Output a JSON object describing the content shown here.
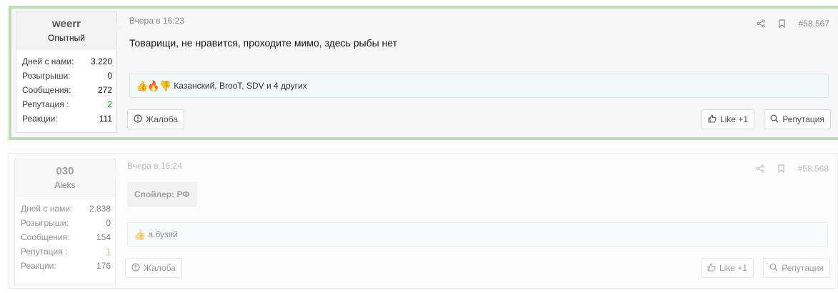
{
  "posts": [
    {
      "user": {
        "name": "weerr",
        "title": "Опытный",
        "stats": [
          {
            "label": "Дней с нами:",
            "value": "3.220"
          },
          {
            "label": "Розыгрыши:",
            "value": "0"
          },
          {
            "label": "Сообщения:",
            "value": "272"
          },
          {
            "label": "Репутация :",
            "value": "2"
          },
          {
            "label": "Реакции:",
            "value": "111"
          }
        ]
      },
      "date": "Вчера в 16:23",
      "post_number": "#58.567",
      "message": "Товарищи, не нравится, проходите мимо, здесь рыбы нет",
      "reactions": {
        "emoji": "👍🔥👎",
        "text": "Казанский, BrooT, SDV и 4 других"
      },
      "report_label": "Жалоба",
      "like_label": "Like +1",
      "reputation_label": "Репутация"
    },
    {
      "user": {
        "name": "030",
        "title": "Aleks",
        "stats": [
          {
            "label": "Дней с нами:",
            "value": "2.838"
          },
          {
            "label": "Розыгрыши:",
            "value": "0"
          },
          {
            "label": "Сообщения:",
            "value": "154"
          },
          {
            "label": "Репутация :",
            "value": "1"
          },
          {
            "label": "Реакции:",
            "value": "176"
          }
        ]
      },
      "date": "Вчера в 16:24",
      "post_number": "#58.568",
      "spoiler_label": "Спойлер: РФ",
      "reactions": {
        "emoji": "👍",
        "text": "а.бузяй"
      },
      "report_label": "Жалоба",
      "like_label": "Like +1",
      "reputation_label": "Репутация"
    }
  ],
  "colors": {
    "highlight_border": "#b9e0b4",
    "reputation_positive": "#1e9b1e"
  },
  "icons": {
    "share": "share-icon",
    "bookmark": "bookmark-icon",
    "report": "alert-circle-icon",
    "like": "thumbs-up-icon",
    "reputation": "search-icon"
  }
}
